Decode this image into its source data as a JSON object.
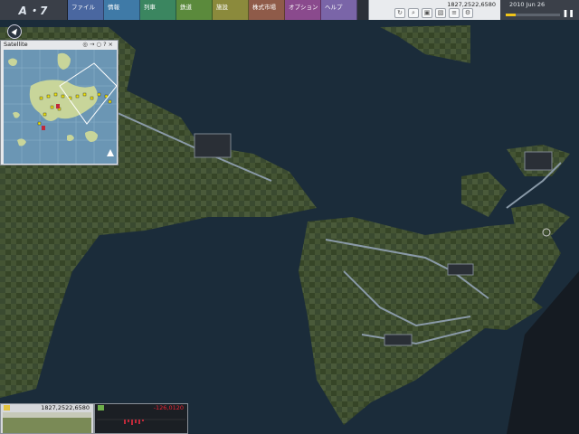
{
  "header": {
    "logo": "A・7",
    "menu": [
      {
        "label": "ファイル",
        "color": "#4a67a0"
      },
      {
        "label": "情報",
        "color": "#3f7aa7"
      },
      {
        "label": "列車",
        "color": "#3b8660"
      },
      {
        "label": "鉄道",
        "color": "#5b8a3c"
      },
      {
        "label": "施設",
        "color": "#8b8a3c"
      },
      {
        "label": "株式市場",
        "color": "#8f5b49"
      },
      {
        "label": "オプション",
        "color": "#8a4a8d"
      },
      {
        "label": "ヘルプ",
        "color": "#7a65a8"
      }
    ],
    "money": "1827,2522,6580",
    "tools": [
      "rotate-icon",
      "search-icon",
      "building-icon",
      "cube-icon",
      "layers-icon",
      "settings-icon"
    ],
    "date": "2010  Jun  26",
    "speed_fraction": 0.18
  },
  "satellite": {
    "title": "Satellite",
    "icons": [
      "eye-icon",
      "arrow-icon",
      "chat-icon",
      "?",
      "×"
    ]
  },
  "bottom": {
    "assets": "1827,2522,6580",
    "profit": "-126,0120"
  },
  "colors": {
    "water": "#1b2c3a",
    "land": "#3a4a30",
    "sat_water": "#6b96b4",
    "sat_land": "#c8d59a",
    "profit_bar": "#c0293a",
    "asset_bar": "#7a8a56"
  }
}
